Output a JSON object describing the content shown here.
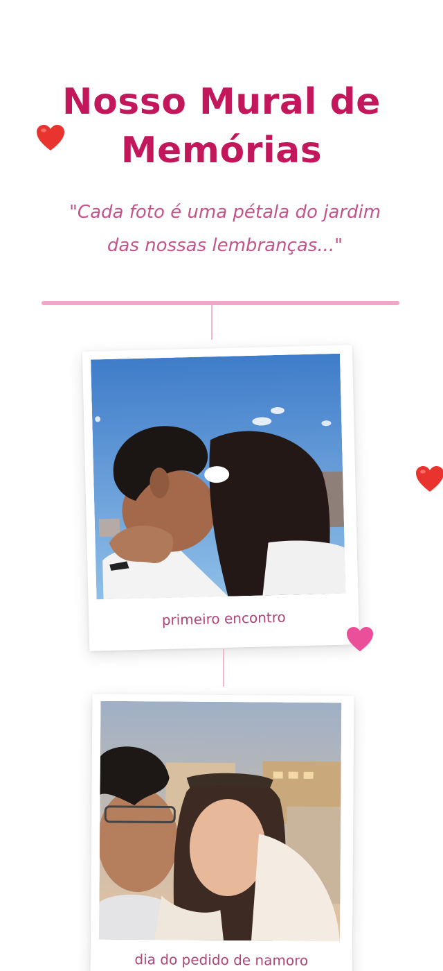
{
  "page": {
    "title_line1": "Nosso Mural de",
    "title_line2": "Memórias",
    "quote_line1": "\"Cada foto é uma pétala do jardim",
    "quote_line2": "das nossas lembranças...\""
  },
  "memories": [
    {
      "caption": "primeiro encontro",
      "photo": "couple-kissing-blue-sky-photo"
    },
    {
      "caption": "dia do pedido de namoro",
      "photo": "couple-kiss-selfie-sunset-photo"
    }
  ],
  "decorations": {
    "icons": [
      "red-heart-icon",
      "red-heart-icon",
      "pink-heart-icon"
    ]
  },
  "colors": {
    "title": "#c2185b",
    "quote": "#c2548a",
    "divider": "#f5a3c7",
    "caption": "#b0457a",
    "heart_red": "#e8332e",
    "heart_pink": "#ec4f9a"
  }
}
